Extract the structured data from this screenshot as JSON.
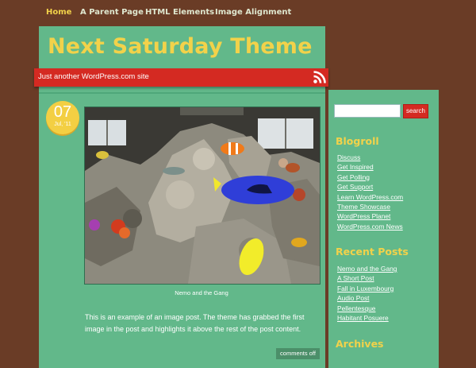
{
  "nav": {
    "items": [
      {
        "label": "Home",
        "active": true
      },
      {
        "label": "A Parent Page",
        "active": false
      },
      {
        "label": "HTML Elements",
        "active": false
      },
      {
        "label": "Image Alignment",
        "active": false
      }
    ]
  },
  "header": {
    "site_title": "Next Saturday Theme",
    "tagline": "Just another WordPress.com site",
    "rss_icon": "rss-feed-icon"
  },
  "post": {
    "date": {
      "day": "07",
      "month": "Jul, '11"
    },
    "image_caption": "Nemo and the Gang",
    "excerpt": "This is an example of an image post. The theme has grabbed the first image in the post and highlights it above the rest of the post content.",
    "comments_label": "comments off"
  },
  "sidebar": {
    "search": {
      "placeholder": "",
      "button_label": "search"
    },
    "blogroll": {
      "title": "Blogroll",
      "links": [
        "Discuss",
        "Get Inspired",
        "Get Polling",
        "Get Support",
        "Learn WordPress.com",
        "Theme Showcase",
        "WordPress Planet",
        "WordPress.com News"
      ]
    },
    "recent_posts": {
      "title": "Recent Posts",
      "links": [
        "Nemo and the Gang",
        "A Short Post",
        "Fall in Luxembourg",
        "Audio Post",
        "Pellentesque",
        "Habitant Posuere"
      ]
    },
    "archives": {
      "title": "Archives"
    }
  },
  "colors": {
    "page_background": "#6a3c26",
    "panel_green": "#62b88a",
    "accent_yellow": "#f2d24a",
    "accent_red": "#d42a22"
  }
}
